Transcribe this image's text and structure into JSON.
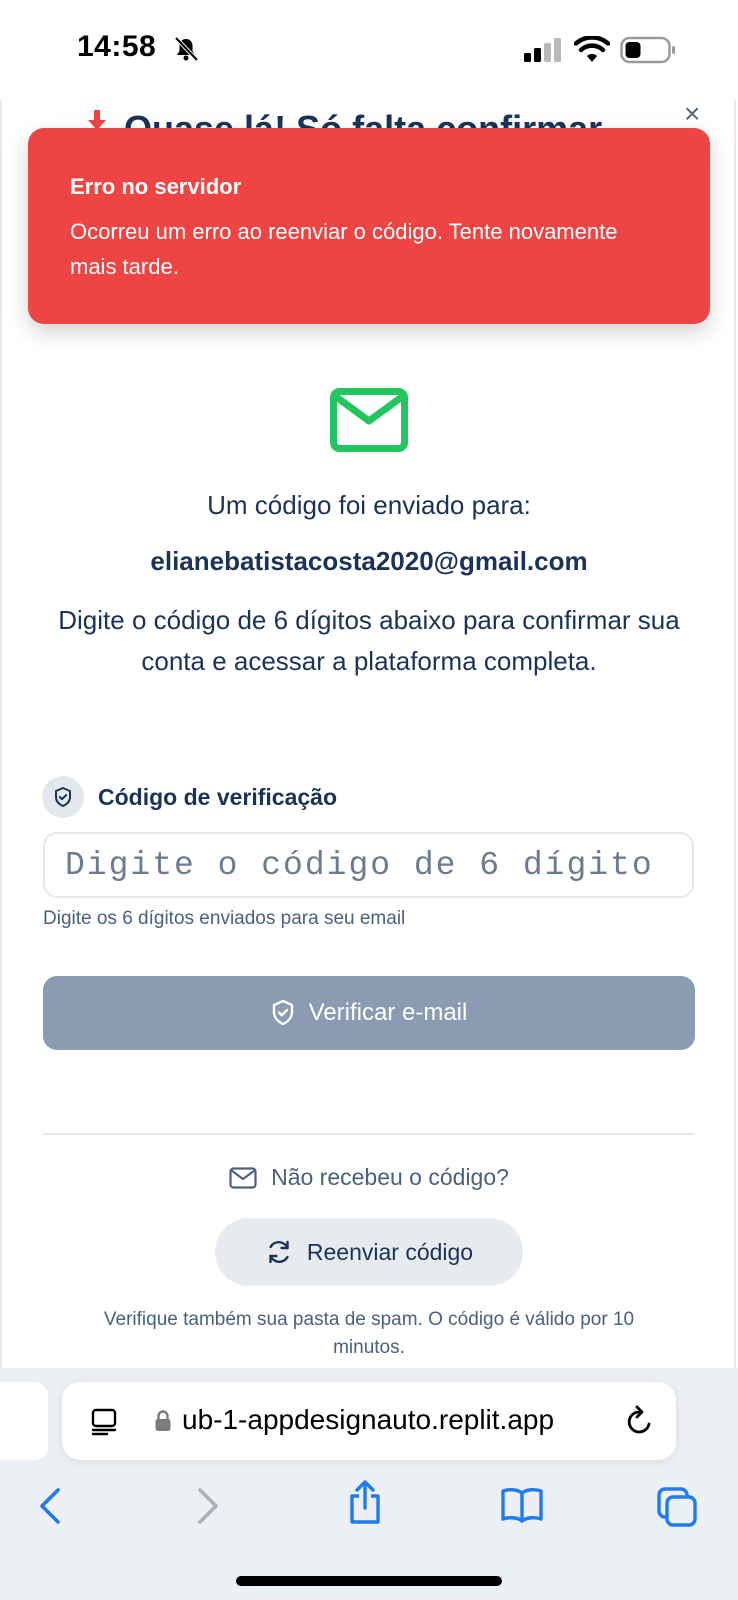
{
  "status_bar": {
    "time": "14:58"
  },
  "page": {
    "peek_title": "Quase lá! Só falta confirmar",
    "close_label": "×"
  },
  "toast": {
    "title": "Erro no servidor",
    "message": "Ocorreu um erro ao reenviar o código. Tente novamente mais tarde."
  },
  "verification": {
    "sent_to_label": "Um código foi enviado para:",
    "email": "elianebatistacosta2020@gmail.com",
    "instructions": "Digite o código de 6 dígitos abaixo para confirmar sua conta e acessar a plataforma completa.",
    "code_label": "Código de verificação",
    "code_placeholder": "Digite o código de 6 dígito",
    "helper": "Digite os 6 dígitos enviados para seu email",
    "verify_button": "Verificar e-mail",
    "no_code_label": "Não recebeu o código?",
    "resend_button": "Reenviar código",
    "spam_note": "Verifique também sua pasta de spam. O código é válido por 10 minutos."
  },
  "browser": {
    "url": "ub-1-appdesignauto.replit.app"
  },
  "colors": {
    "toast_bg": "#ef4444",
    "mail_icon": "#22c55e",
    "verify_button_bg": "#8a9bb2",
    "text_primary": "#1b3358"
  }
}
